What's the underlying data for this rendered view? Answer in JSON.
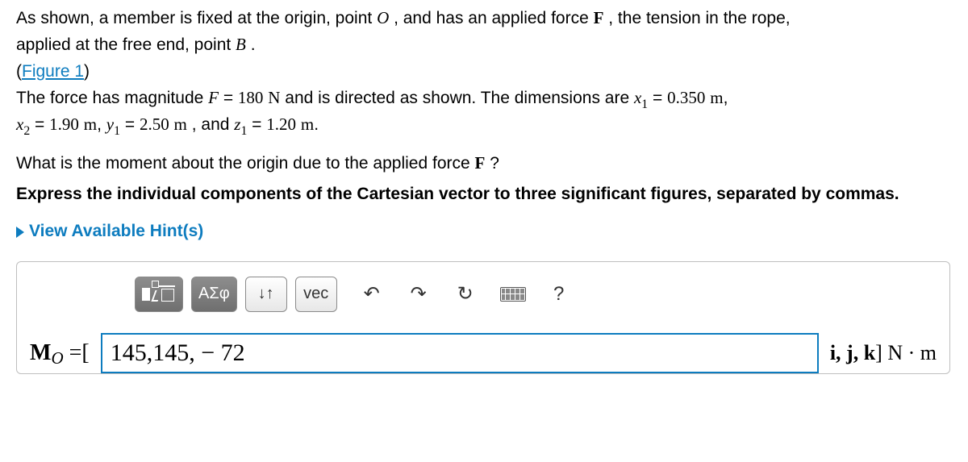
{
  "problem": {
    "intro_l1": "As shown, a member is fixed at the origin, point ",
    "pointO": "O",
    "intro_l1b": ", and has an applied force ",
    "F_bold": "F",
    "intro_l1c": ", the tension in the rope,",
    "intro_l2a": "applied at the free end, point ",
    "pointB": "B",
    "intro_l2b": ".",
    "figure_link": "Figure 1",
    "line3a": "The force has magnitude ",
    "F_it": "F",
    "eq": " = ",
    "F_val": "180",
    "N_unit": " N",
    "line3b": " and is directed as shown. The dimensions are ",
    "x": "x",
    "one": "1",
    "two": "2",
    "y": "y",
    "z": "z",
    "x1_val": "0.350",
    "m_unit": " m",
    "comma": ",",
    "x2_val": "1.90",
    "y1_val": "2.50",
    "and": ", and ",
    "z1_val": "1.20",
    "period": "."
  },
  "question": {
    "text_a": "What is the moment about the origin due to the applied force ",
    "F_bold": "F",
    "text_b": "?"
  },
  "instruction": "Express the individual components of the Cartesian vector to three significant figures, separated by commas.",
  "hints_label": "View Available Hint(s)",
  "toolbar": {
    "greek": "ΑΣφ",
    "updown": "↓↑",
    "vec": "vec",
    "undo": "↶",
    "redo": "↷",
    "reset": "↻",
    "help": "?"
  },
  "answer": {
    "lhs_M": "M",
    "lhs_O": "O",
    "lhs_eq": " =[",
    "value": "145,145, − 72",
    "rhs_vec": "i, j, k",
    "rhs_close": "] ",
    "rhs_unit": "N · m"
  }
}
